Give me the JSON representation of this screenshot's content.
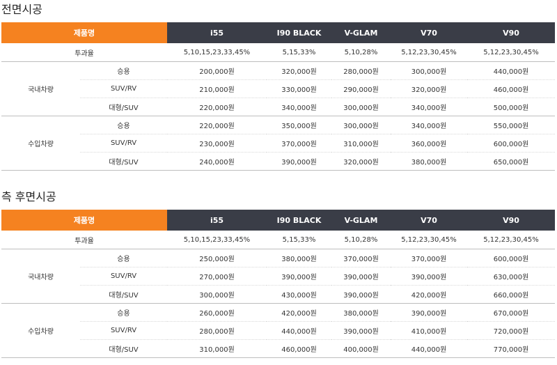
{
  "header": {
    "product_label": "제품명",
    "products": [
      "i55",
      "I90 BLACK",
      "V-GLAM",
      "V70",
      "V90"
    ]
  },
  "sections": [
    {
      "title": "전면시공",
      "transmission_label": "투과율",
      "transmission": [
        "5,10,15,23,33,45%",
        "5,15,33%",
        "5,10,28%",
        "5,12,23,30,45%",
        "5,12,23,30,45%"
      ],
      "groups": [
        {
          "name": "국내차량",
          "rows": [
            {
              "type": "승용",
              "prices": [
                "200,000원",
                "320,000원",
                "280,000원",
                "300,000원",
                "440,000원"
              ]
            },
            {
              "type": "SUV/RV",
              "prices": [
                "210,000원",
                "330,000원",
                "290,000원",
                "320,000원",
                "460,000원"
              ]
            },
            {
              "type": "대형/SUV",
              "prices": [
                "220,000원",
                "340,000원",
                "300,000원",
                "340,000원",
                "500,000원"
              ]
            }
          ]
        },
        {
          "name": "수입차량",
          "rows": [
            {
              "type": "승용",
              "prices": [
                "220,000원",
                "350,000원",
                "300,000원",
                "340,000원",
                "550,000원"
              ]
            },
            {
              "type": "SUV/RV",
              "prices": [
                "230,000원",
                "370,000원",
                "310,000원",
                "360,000원",
                "600,000원"
              ]
            },
            {
              "type": "대형/SUV",
              "prices": [
                "240,000원",
                "390,000원",
                "320,000원",
                "380,000원",
                "650,000원"
              ]
            }
          ]
        }
      ]
    },
    {
      "title": "측 후면시공",
      "transmission_label": "투과율",
      "transmission": [
        "5,10,15,23,33,45%",
        "5,15,33%",
        "5,10,28%",
        "5,12,23,30,45%",
        "5,12,23,30,45%"
      ],
      "groups": [
        {
          "name": "국내차량",
          "rows": [
            {
              "type": "승용",
              "prices": [
                "250,000원",
                "380,000원",
                "370,000원",
                "370,000원",
                "600,000원"
              ]
            },
            {
              "type": "SUV/RV",
              "prices": [
                "270,000원",
                "390,000원",
                "390,000원",
                "390,000원",
                "630,000원"
              ]
            },
            {
              "type": "대형/SUV",
              "prices": [
                "300,000원",
                "430,000원",
                "390,000원",
                "420,000원",
                "660,000원"
              ]
            }
          ]
        },
        {
          "name": "수입차량",
          "rows": [
            {
              "type": "승용",
              "prices": [
                "260,000원",
                "420,000원",
                "380,000원",
                "390,000원",
                "670,000원"
              ]
            },
            {
              "type": "SUV/RV",
              "prices": [
                "280,000원",
                "440,000원",
                "390,000원",
                "410,000원",
                "720,000원"
              ]
            },
            {
              "type": "대형/SUV",
              "prices": [
                "310,000원",
                "460,000원",
                "400,000원",
                "440,000원",
                "770,000원"
              ]
            }
          ]
        }
      ]
    }
  ],
  "colors": {
    "accent_orange": "#f58220",
    "header_dark": "#3a3d47"
  }
}
